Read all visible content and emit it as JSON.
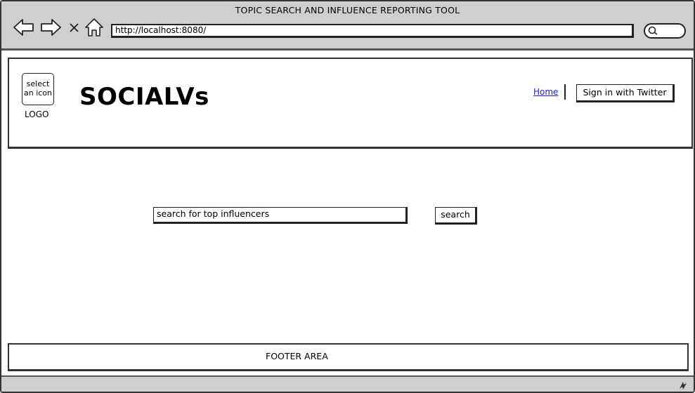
{
  "window": {
    "title": "TOPIC SEARCH AND INFLUENCE REPORTING TOOL"
  },
  "browser": {
    "url": "http://localhost:8080/",
    "icons": [
      "back-arrow-icon",
      "forward-arrow-icon",
      "close-icon",
      "home-icon",
      "search-icon",
      "resize-grip-icon"
    ]
  },
  "header": {
    "logo_placeholder": "select an icon",
    "logo_caption": "LOGO",
    "brand": "SOCIALVs",
    "nav": {
      "home_label": "Home",
      "signin_label": "Sign in with Twitter"
    }
  },
  "search": {
    "input_value": "search for top influencers",
    "button_label": "search"
  },
  "footer": {
    "label": "FOOTER AREA"
  },
  "colors": {
    "chrome": "#cfcfcf",
    "link": "#1a1aee",
    "border": "#222222"
  }
}
